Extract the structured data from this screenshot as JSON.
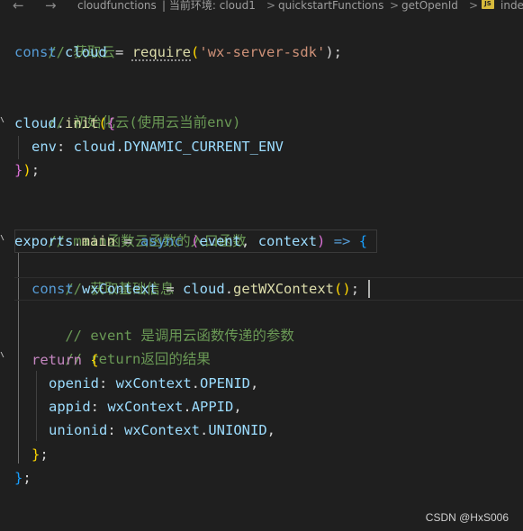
{
  "breadcrumb": {
    "back": "←",
    "forward": "→",
    "items": [
      "cloudfunctions",
      "| 当前环境: cloud1",
      "quickstartFunctions",
      "getOpenId",
      "inde"
    ],
    "separator": ">",
    "file_badge": "JS"
  },
  "code": {
    "l1_comment": "// 获取云",
    "l2_const": "const",
    "l2_var": "cloud",
    "l2_eq": " = ",
    "l2_fn": "require",
    "l2_open": "(",
    "l2_str": "'wx-server-sdk'",
    "l2_close": ");",
    "l4_comment": "// 初始化云(使用云当前env)",
    "l5_obj": "cloud",
    "l5_dot": ".",
    "l5_fn": "init",
    "l5_p1": "(",
    "l5_p2": "{",
    "l6_prop": "env",
    "l6_colon": ": ",
    "l6_obj": "cloud",
    "l6_dot": ".",
    "l6_const": "DYNAMIC_CURRENT_ENV",
    "l7_b1": "}",
    "l7_b2": ")",
    "l7_semi": ";",
    "l9_comment": "// main函数云函数的入口函数",
    "l10_exports": "exports",
    "l10_dot": ".",
    "l10_main": "main",
    "l10_eq": " = ",
    "l10_async": "async",
    "l10_p_open": "(",
    "l10_event": "event",
    "l10_comma": ", ",
    "l10_context": "context",
    "l10_p_close": ")",
    "l10_arrow": " => ",
    "l10_brace": "{",
    "l11_comment": "// 获取基础信息",
    "l12_const": "const",
    "l12_var": "wxContext",
    "l12_eq": " = ",
    "l12_obj": "cloud",
    "l12_dot": ".",
    "l12_fn": "getWXContext",
    "l12_paren": "()",
    "l12_semi": ";",
    "l13_comment": "// event 是调用云函数传递的参数",
    "l14_comment": "// return返回的结果",
    "l15_return": "return",
    "l15_brace": "{",
    "l16_key": "openid",
    "l16_colon": ": ",
    "l16_obj": "wxContext",
    "l16_dot": ".",
    "l16_const": "OPENID",
    "l16_comma": ",",
    "l17_key": "appid",
    "l17_colon": ": ",
    "l17_obj": "wxContext",
    "l17_dot": ".",
    "l17_const": "APPID",
    "l17_comma": ",",
    "l18_key": "unionid",
    "l18_colon": ": ",
    "l18_obj": "wxContext",
    "l18_dot": ".",
    "l18_const": "UNIONID",
    "l18_comma": ",",
    "l19_brace": "}",
    "l19_semi": ";",
    "l20_brace": "}",
    "l20_semi": ";"
  },
  "watermark": "CSDN @HxS006",
  "theme": {
    "background": "#1f1f1f",
    "comment": "#6a9955",
    "keyword": "#569cd6",
    "variable": "#9cdcfe",
    "function": "#dcdcaa",
    "string": "#ce9178",
    "bracket_gold": "#ffd700",
    "bracket_purple": "#da70d6",
    "bracket_blue": "#179fff"
  }
}
